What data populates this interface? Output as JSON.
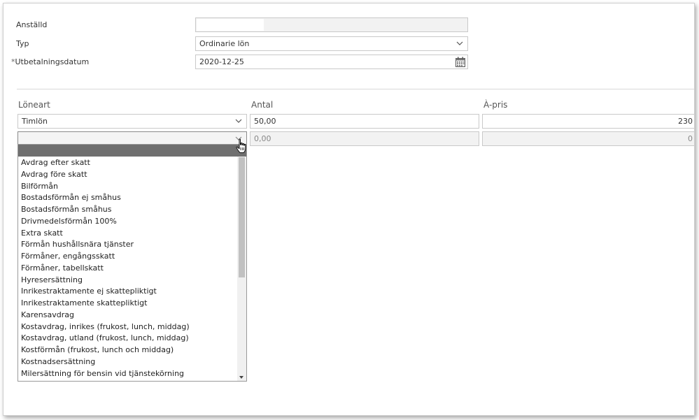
{
  "form": {
    "employee_label": "Anställd",
    "employee_value": "",
    "type_label": "Typ",
    "type_value": "Ordinarie lön",
    "payment_date_required_mark": "*",
    "payment_date_label": "Utbetalningsdatum",
    "payment_date_value": "2020-12-25"
  },
  "table": {
    "col_wage_type": "Löneart",
    "col_quantity": "Antal",
    "col_unit_price": "À-pris",
    "rows": [
      {
        "wage_type": "Timlön",
        "quantity": "50,00",
        "unit_price": "230"
      },
      {
        "wage_type": "",
        "quantity": "0,00",
        "unit_price": "0"
      }
    ]
  },
  "dropdown": {
    "items": [
      "Avdrag efter skatt",
      "Avdrag före skatt",
      "Bilförmån",
      "Bostadsförmån ej småhus",
      "Bostadsförmån småhus",
      "Drivmedelsförmån 100%",
      "Extra skatt",
      "Förmån hushållsnära tjänster",
      "Förmåner, engångsskatt",
      "Förmåner, tabellskatt",
      "Hyresersättning",
      "Inrikestraktamente ej skattepliktigt",
      "Inrikestraktamente skattepliktigt",
      "Karensavdrag",
      "Kostavdrag, inrikes (frukost, lunch, middag)",
      "Kostavdrag, utland (frukost, lunch, middag)",
      "Kostförmån (frukost, lunch och middag)",
      "Kostnadsersättning",
      "Milersättning för bensin vid tjänstekörning"
    ]
  }
}
